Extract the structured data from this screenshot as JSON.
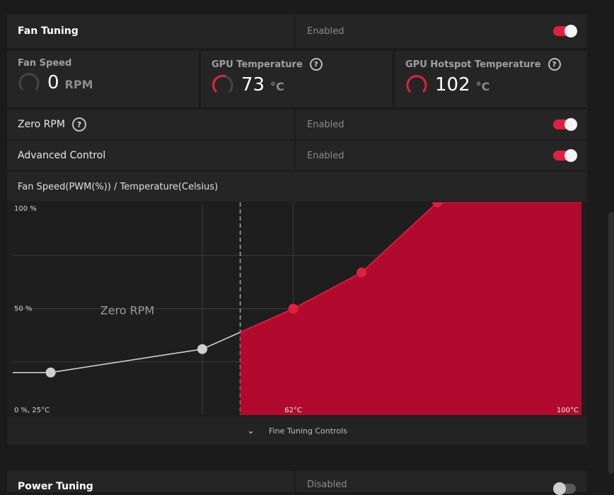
{
  "fan_tuning": {
    "label": "Fan Tuning",
    "state": "Enabled"
  },
  "metrics": [
    {
      "title": "Fan Speed",
      "value": "0",
      "unit": "RPM",
      "help": false,
      "level": 0
    },
    {
      "title": "GPU Temperature",
      "value": "73",
      "unit": "°C",
      "help": true,
      "level": 0.73
    },
    {
      "title": "GPU Hotspot Temperature",
      "value": "102",
      "unit": "°C",
      "help": true,
      "level": 1.0
    }
  ],
  "zero_rpm": {
    "label": "Zero RPM",
    "state": "Enabled"
  },
  "advanced_control": {
    "label": "Advanced Control",
    "state": "Enabled"
  },
  "chart_title": "Fan Speed(PWM(%)) / Temperature(Celsius)",
  "chart_data": {
    "type": "area",
    "y_labels": [
      "100 %",
      "50 %",
      "0 %, 25°C"
    ],
    "x_labels": [
      "62°C",
      "100°C"
    ],
    "zero_rpm_label": "Zero RPM",
    "zero_rpm_limit_temp": 55,
    "x_range": [
      25,
      100
    ],
    "y_range": [
      0,
      100
    ],
    "points": [
      {
        "temp": 30,
        "pwm": 20
      },
      {
        "temp": 50,
        "pwm": 31
      },
      {
        "temp": 62,
        "pwm": 50
      },
      {
        "temp": 71,
        "pwm": 67
      },
      {
        "temp": 81,
        "pwm": 100
      }
    ],
    "accent": "#e0203f",
    "fill": "#b10a2e",
    "inactive_point": "#cfcfcf"
  },
  "footer": {
    "label": "Fine Tuning Controls"
  },
  "power_tuning": {
    "label": "Power Tuning",
    "state": "Disabled"
  }
}
